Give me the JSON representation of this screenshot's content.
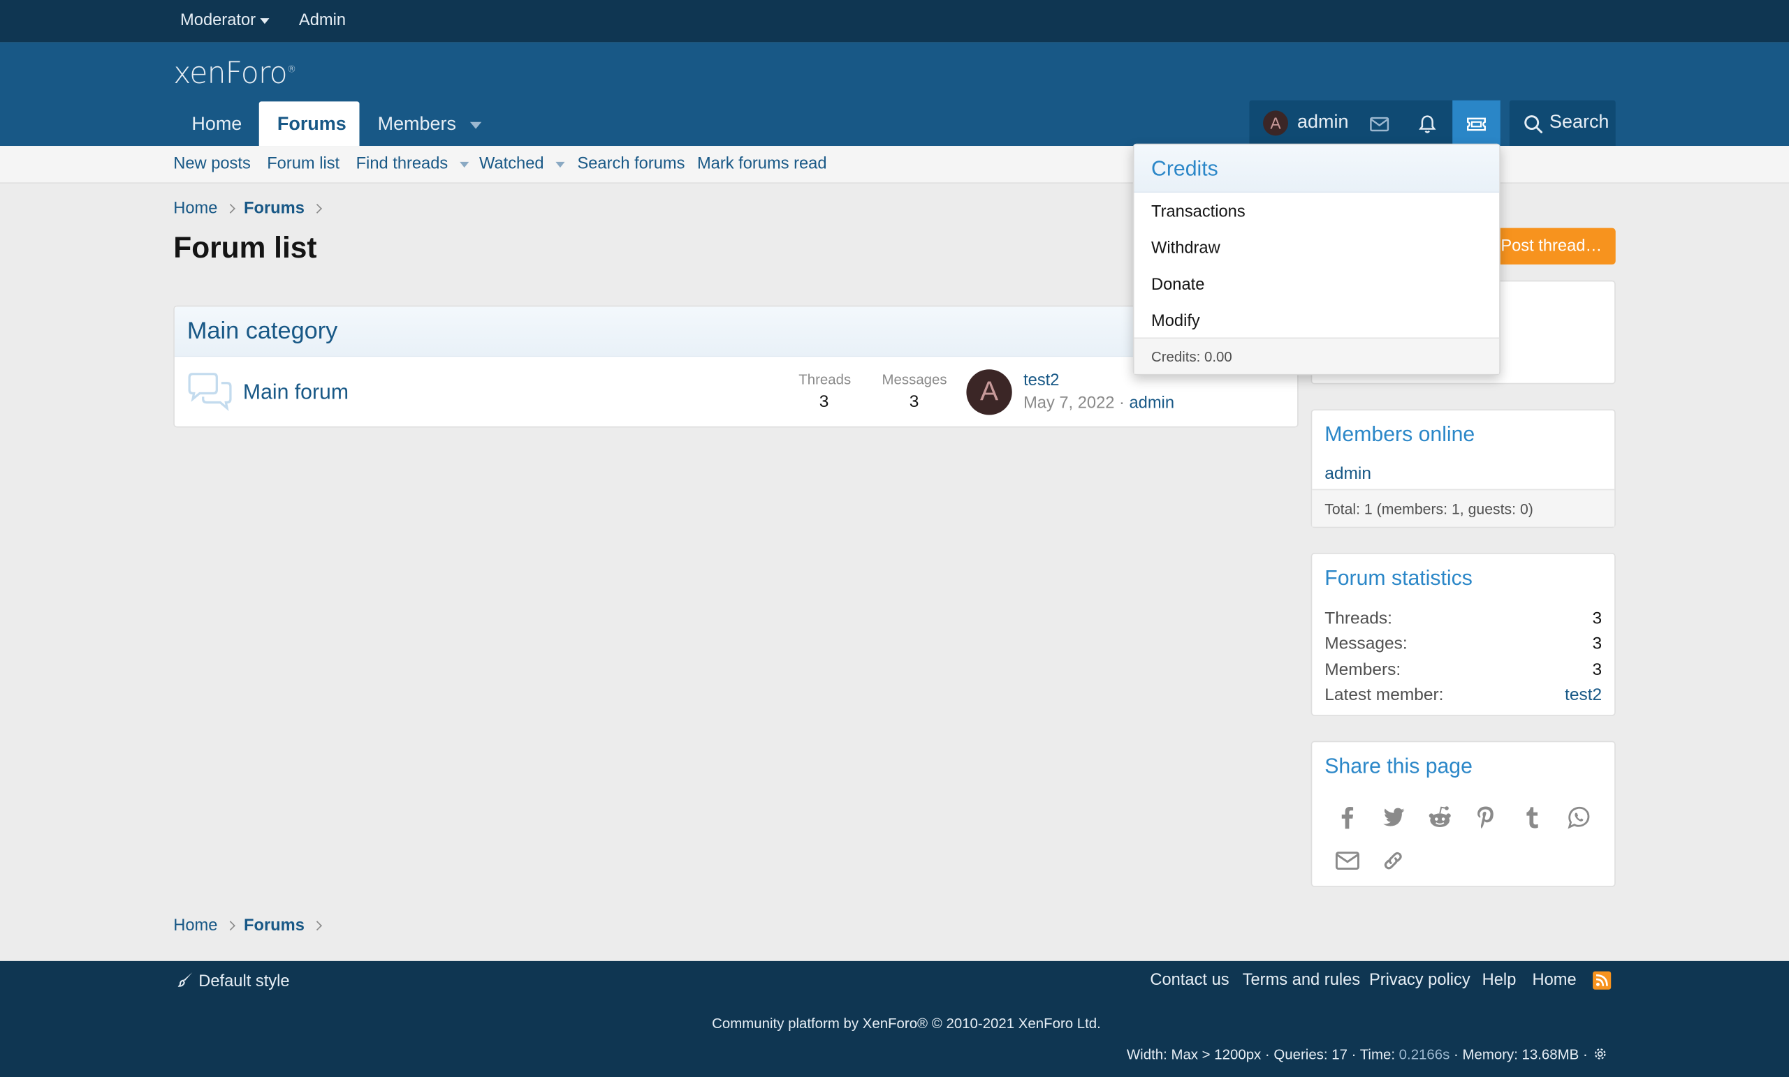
{
  "staffbar": {
    "moderator": "Moderator",
    "admin": "Admin"
  },
  "header": {
    "logo": "xenForo",
    "tabs": {
      "home": "Home",
      "forums": "Forums",
      "members": "Members"
    },
    "user": {
      "avatar_letter": "A",
      "name": "admin"
    },
    "search": "Search"
  },
  "subnav": {
    "new_posts": "New posts",
    "forum_list": "Forum list",
    "find_threads": "Find threads",
    "watched": "Watched",
    "search_forums": "Search forums",
    "mark_read": "Mark forums read"
  },
  "breadcrumb": {
    "home": "Home",
    "forums": "Forums"
  },
  "page": {
    "title": "Forum list",
    "post_thread": "Post thread…"
  },
  "category": {
    "title": "Main category",
    "forum": {
      "title": "Main forum",
      "threads_label": "Threads",
      "threads": "3",
      "messages_label": "Messages",
      "messages": "3",
      "avatar_letter": "A",
      "last_title": "test2",
      "last_date": "May 7, 2022",
      "last_sep": " · ",
      "last_user": "admin"
    }
  },
  "members_online": {
    "title": "Members online",
    "member": "admin",
    "total": "Total: 1 (members: 1, guests: 0)"
  },
  "forum_stats": {
    "title": "Forum statistics",
    "rows": [
      {
        "label": "Threads:",
        "value": "3"
      },
      {
        "label": "Messages:",
        "value": "3"
      },
      {
        "label": "Members:",
        "value": "3"
      },
      {
        "label": "Latest member:",
        "value": "test2"
      }
    ]
  },
  "share": {
    "title": "Share this page"
  },
  "credits_menu": {
    "title": "Credits",
    "items": [
      "Transactions",
      "Withdraw",
      "Donate",
      "Modify"
    ],
    "footer": "Credits: 0.00"
  },
  "footer": {
    "style": "Default style",
    "links": [
      "Contact us",
      "Terms and rules",
      "Privacy policy",
      "Help",
      "Home"
    ],
    "copyright": "Community platform by XenForo® © 2010-2021 XenForo Ltd.",
    "debug_prefix": "Width: Max > 1200px · Queries: 17 · Time: ",
    "debug_time": "0.2166s",
    "debug_suffix": " · Memory: 13.68MB ·"
  },
  "colors": {
    "accent": "#185886",
    "link": "#2b87c8",
    "button": "#f7931e",
    "dark": "#0f3652"
  }
}
